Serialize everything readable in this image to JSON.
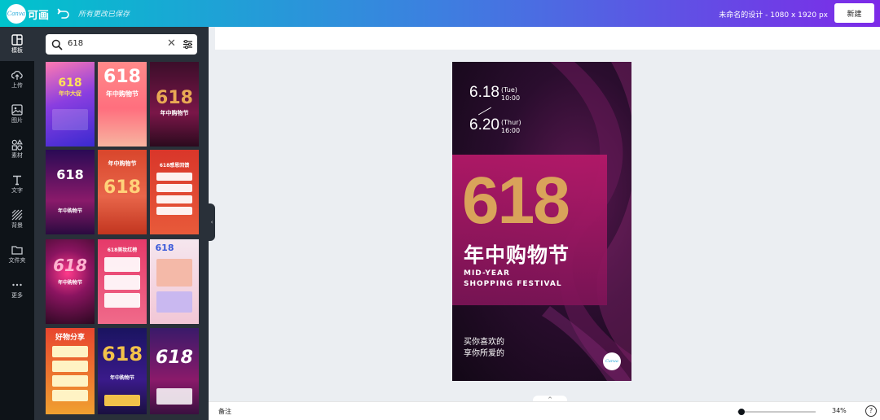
{
  "topbar": {
    "logo_text": "Canva",
    "brand": "可画",
    "save_status": "所有更改已保存",
    "doc_title": "未命名的设计 - 1080 x 1920 px",
    "new_button": "新建"
  },
  "nav": {
    "items": [
      {
        "label": "模板",
        "icon": "template-icon",
        "active": true
      },
      {
        "label": "上传",
        "icon": "upload-icon"
      },
      {
        "label": "图片",
        "icon": "image-icon"
      },
      {
        "label": "素材",
        "icon": "elements-icon"
      },
      {
        "label": "文字",
        "icon": "text-icon"
      },
      {
        "label": "背景",
        "icon": "background-icon"
      },
      {
        "label": "文件夹",
        "icon": "folder-icon"
      },
      {
        "label": "更多",
        "icon": "more-icon"
      }
    ]
  },
  "search": {
    "value": "618",
    "clear_icon": "close-icon",
    "filter_icon": "filter-icon"
  },
  "templates": [
    {
      "title": "618",
      "subtitle": "年中大促"
    },
    {
      "title": "618",
      "subtitle": "年中购物节"
    },
    {
      "title": "618",
      "subtitle": "年中购物节"
    },
    {
      "title": "618",
      "subtitle": "年中购物节"
    },
    {
      "title": "618",
      "subtitle": "年中购物节"
    },
    {
      "title": "618",
      "subtitle": "618感恩回馈"
    },
    {
      "title": "618",
      "subtitle": "年中购物节"
    },
    {
      "title": "618",
      "subtitle": "618美妆红榜"
    },
    {
      "title": "618",
      "subtitle": ""
    },
    {
      "title": "",
      "subtitle": "好物分享"
    },
    {
      "title": "618",
      "subtitle": "年中购物节"
    },
    {
      "title": "618",
      "subtitle": ""
    }
  ],
  "design": {
    "date1": "6.18",
    "date1_day": "(Tue)",
    "date1_time": "10:00",
    "date2": "6.20",
    "date2_day": "(Thur)",
    "date2_time": "16:00",
    "big_number": "618",
    "cn_title": "年中购物节",
    "en_line1": "MID-YEAR",
    "en_line2": "SHOPPING FESTIVAL",
    "tag1": "买你喜欢的",
    "tag2": "享你所爱的",
    "logo_text": "Canva",
    "colors": {
      "gold": "#d9a35a",
      "magenta": "#b8196a",
      "dark": "#120816"
    }
  },
  "bottombar": {
    "notes": "备注",
    "zoom": "34%",
    "zoom_fraction": 0.34,
    "help": "?"
  }
}
